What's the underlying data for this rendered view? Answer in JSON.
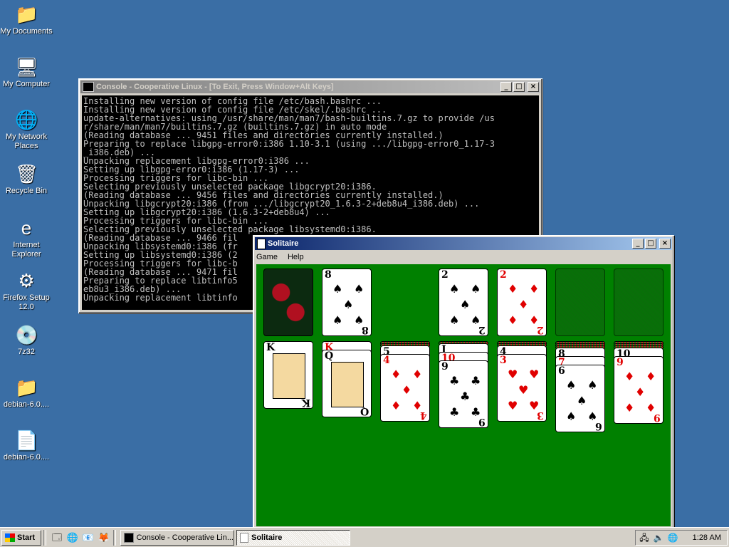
{
  "desktop": {
    "icons": [
      {
        "label": "My Documents",
        "glyph": "📁"
      },
      {
        "label": "My Computer",
        "glyph": "🖥"
      },
      {
        "label": "My Network Places",
        "glyph": "🌐"
      },
      {
        "label": "Recycle Bin",
        "glyph": "🗑"
      },
      {
        "label": "Internet Explorer",
        "glyph": "e"
      },
      {
        "label": "Firefox Setup 12.0",
        "glyph": "⚙"
      },
      {
        "label": "7z32",
        "glyph": "💿"
      },
      {
        "label": "debian-6.0....",
        "glyph": "📁"
      },
      {
        "label": "debian-6.0....",
        "glyph": "📄"
      }
    ]
  },
  "console": {
    "title": "Console - Cooperative Linux - [To Exit, Press Window+Alt Keys]",
    "lines": [
      "Installing new version of config file /etc/bash.bashrc ...",
      "Installing new version of config file /etc/skel/.bashrc ...",
      "update-alternatives: using /usr/share/man/man7/bash-builtins.7.gz to provide /us",
      "r/share/man/man7/builtins.7.gz (builtins.7.gz) in auto mode",
      "(Reading database ... 9451 files and directories currently installed.)",
      "Preparing to replace libgpg-error0:i386 1.10-3.1 (using .../libgpg-error0_1.17-3",
      "_i386.deb) ...",
      "Unpacking replacement libgpg-error0:i386 ...",
      "Setting up libgpg-error0:i386 (1.17-3) ...",
      "Processing triggers for libc-bin ...",
      "Selecting previously unselected package libgcrypt20:i386.",
      "(Reading database ... 9456 files and directories currently installed.)",
      "Unpacking libgcrypt20:i386 (from .../libgcrypt20_1.6.3-2+deb8u4_i386.deb) ...",
      "Setting up libgcrypt20:i386 (1.6.3-2+deb8u4) ...",
      "Processing triggers for libc-bin ...",
      "Selecting previously unselected package libsystemd0:i386.",
      "(Reading database ... 9466 fil",
      "Unpacking libsystemd0:i386 (fr",
      "Setting up libsystemd0:i386 (2",
      "Processing triggers for libc-b",
      "(Reading database ... 9471 fil",
      "Preparing to replace libtinfo5",
      "eb8u3_i386.deb) ...",
      "Unpacking replacement libtinfo"
    ]
  },
  "solitaire": {
    "title": "Solitaire",
    "menu": [
      "Game",
      "Help"
    ],
    "foundation": [
      {
        "rank": "2",
        "suit": "♠",
        "color": "blk"
      },
      {
        "rank": "2",
        "suit": "♦",
        "color": "red"
      }
    ],
    "waste": {
      "rank": "8",
      "suit": "♠",
      "color": "blk"
    },
    "tableau": [
      {
        "rank": "K",
        "suit": "♣",
        "color": "blk",
        "hidden": 0,
        "face": true
      },
      {
        "rank": "Q",
        "suit": "♠",
        "color": "blk",
        "hidden": 0,
        "face": true,
        "under": {
          "rank": "K",
          "color": "red"
        }
      },
      {
        "rank": "4",
        "suit": "♦",
        "color": "red",
        "hidden": 2,
        "under": {
          "rank": "5",
          "color": "blk"
        }
      },
      {
        "rank": "9",
        "suit": "♣",
        "color": "blk",
        "hidden": 1,
        "under": {
          "rank": "J",
          "color": "blk"
        },
        "under2": {
          "rank": "10",
          "color": "red"
        }
      },
      {
        "rank": "3",
        "suit": "♥",
        "color": "red",
        "hidden": 2,
        "under": {
          "rank": "4",
          "color": "blk"
        }
      },
      {
        "rank": "6",
        "suit": "♠",
        "color": "blk",
        "hidden": 3,
        "under": {
          "rank": "8",
          "color": "blk"
        },
        "under2": {
          "rank": "7",
          "color": "red"
        }
      },
      {
        "rank": "9",
        "suit": "♦",
        "color": "red",
        "hidden": 3,
        "under": {
          "rank": "10",
          "color": "blk"
        }
      }
    ]
  },
  "taskbar": {
    "start": "Start",
    "quicklaunch": [
      "🗔",
      "🌐",
      "📧",
      "🦊"
    ],
    "tasks": [
      {
        "label": "Console - Cooperative Lin...",
        "active": false
      },
      {
        "label": "Solitaire",
        "active": true
      }
    ],
    "tray": [
      "🖧",
      "🔈",
      "🌐"
    ],
    "clock": "1:28 AM"
  }
}
